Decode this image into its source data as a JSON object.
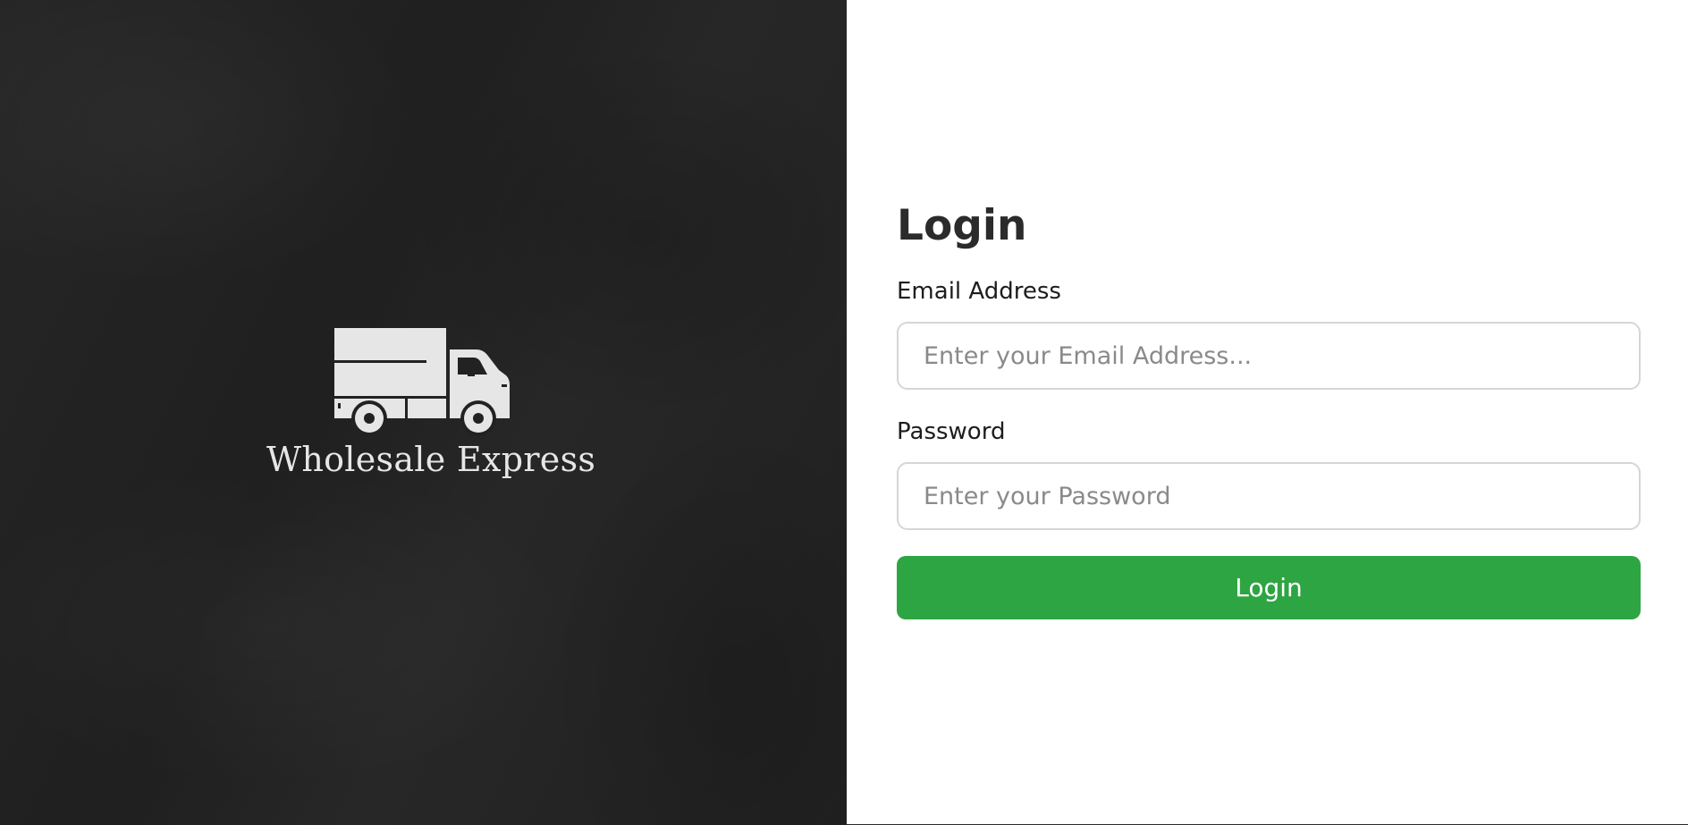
{
  "brand": {
    "name": "Wholesale Express",
    "logo_icon": "delivery-truck-icon",
    "panel_color": "#222222",
    "logo_color": "#e6e6e6"
  },
  "form": {
    "title": "Login",
    "email": {
      "label": "Email Address",
      "placeholder": "Enter your Email Address...",
      "value": ""
    },
    "password": {
      "label": "Password",
      "placeholder": "Enter your Password",
      "value": ""
    },
    "submit_label": "Login",
    "submit_color": "#2ea543"
  }
}
